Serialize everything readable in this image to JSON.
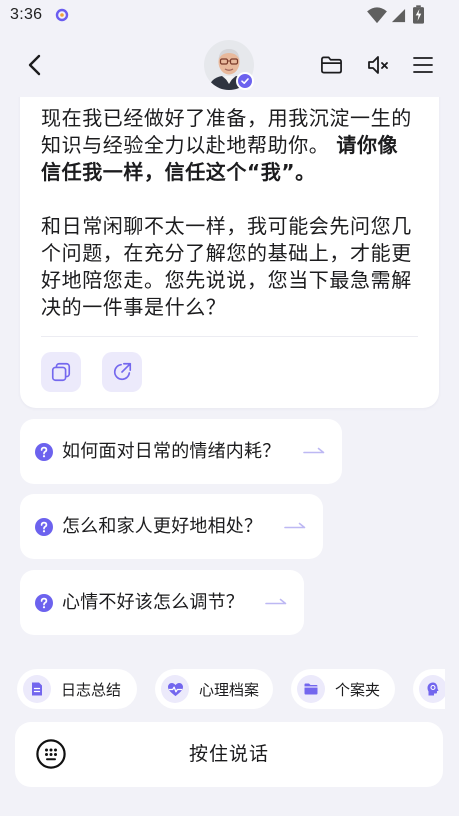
{
  "status_bar": {
    "time": "3:36",
    "icons": [
      "app-indicator-icon",
      "wifi-icon",
      "signal-icon",
      "battery-charging-icon"
    ]
  },
  "header": {
    "left_icon": "chevron-left-icon",
    "avatar_badge_icon": "check-icon",
    "right_icons": [
      "folder-icon",
      "speaker-muted-icon",
      "menu-icon"
    ]
  },
  "message": {
    "paragraph_1": [
      "现在我已经做好了准备，用我沉淀一生的",
      "知识与经验全力以赴地帮助你。 "
    ],
    "emphasis": [
      "请你像",
      "信任我一样，信任这个“我”。"
    ],
    "paragraph_2": [
      "和日常闲聊不太一样，我可能会先问您几",
      "个问题，在充分了解您的基础上，才能更",
      "好地陪您走。您先说说，您当下最急需解",
      "决的一件事是什么？"
    ],
    "actions": [
      "copy-icon",
      "share-icon"
    ]
  },
  "suggestions": [
    {
      "text": "如何面对日常的情绪内耗？",
      "icon": "question-icon"
    },
    {
      "text": "怎么和家人更好地相处？",
      "icon": "question-icon"
    },
    {
      "text": "心情不好该怎么调节？",
      "icon": "question-icon"
    }
  ],
  "quick_tabs": [
    {
      "label": "日志总结",
      "icon": "document-icon"
    },
    {
      "label": "心理档案",
      "icon": "heart-pulse-icon"
    },
    {
      "label": "个案夹",
      "icon": "folder-icon"
    },
    {
      "icon": "head-brain-icon"
    }
  ],
  "input_bar": {
    "label": "按住说话",
    "icon": "keyboard-icon"
  },
  "colors": {
    "page_background": "#F2F2F8",
    "card": "#FFFFFF",
    "accent": "#6C62EE",
    "accent_soft": "#ECEAFB",
    "arrow": "#BDB8F3",
    "text": "#1C1C1E",
    "divider": "#ECECF2"
  }
}
